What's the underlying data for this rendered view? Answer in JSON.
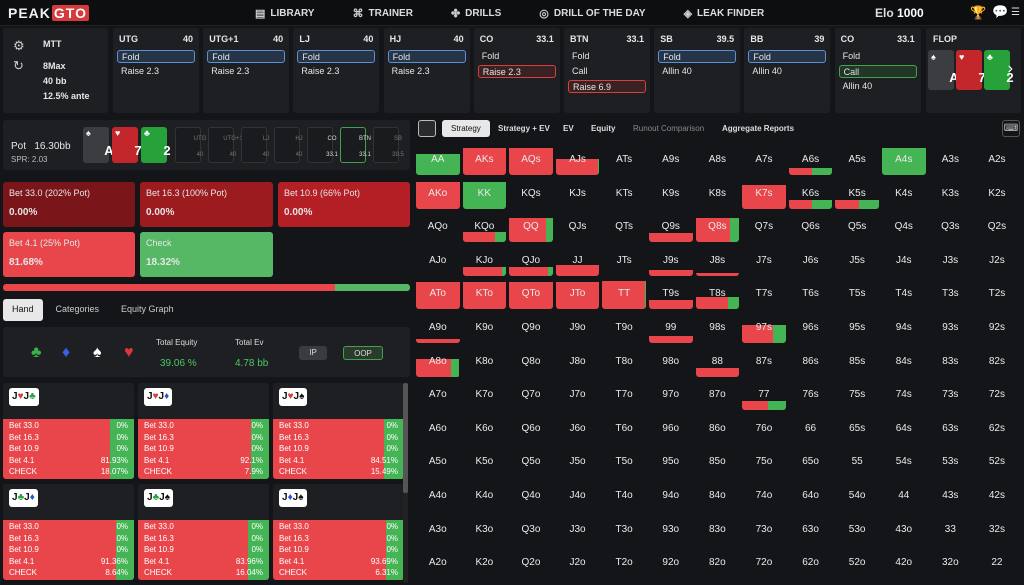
{
  "nav": {
    "logo_a": "PEAK",
    "logo_b": "GTO",
    "items": [
      {
        "icon": "book-icon",
        "label": "LIBRARY"
      },
      {
        "icon": "gamepad-icon",
        "label": "TRAINER"
      },
      {
        "icon": "drills-icon",
        "label": "DRILLS"
      },
      {
        "icon": "target-icon",
        "label": "DRILL OF THE DAY"
      },
      {
        "icon": "drop-icon",
        "label": "LEAK FINDER"
      }
    ],
    "elo_label": "Elo",
    "elo_value": "1000"
  },
  "setup": {
    "format": "MTT",
    "table": "8Max",
    "stack": "40 bb",
    "ante": "12.5% ante"
  },
  "positions": [
    {
      "name": "UTG",
      "stack": "40",
      "opts": [
        {
          "t": "Fold",
          "s": "sel"
        },
        {
          "t": "Raise 2.3",
          "s": ""
        }
      ]
    },
    {
      "name": "UTG+1",
      "stack": "40",
      "opts": [
        {
          "t": "Fold",
          "s": "sel"
        },
        {
          "t": "Raise 2.3",
          "s": ""
        }
      ]
    },
    {
      "name": "LJ",
      "stack": "40",
      "opts": [
        {
          "t": "Fold",
          "s": "sel"
        },
        {
          "t": "Raise 2.3",
          "s": ""
        }
      ]
    },
    {
      "name": "HJ",
      "stack": "40",
      "opts": [
        {
          "t": "Fold",
          "s": "sel"
        },
        {
          "t": "Raise 2.3",
          "s": ""
        }
      ]
    },
    {
      "name": "CO",
      "stack": "33.1",
      "opts": [
        {
          "t": "Fold",
          "s": ""
        },
        {
          "t": "Raise 2.3",
          "s": "selr"
        }
      ]
    },
    {
      "name": "BTN",
      "stack": "33.1",
      "opts": [
        {
          "t": "Fold",
          "s": ""
        },
        {
          "t": "Call",
          "s": ""
        },
        {
          "t": "Raise 6.9",
          "s": "selr"
        }
      ]
    },
    {
      "name": "SB",
      "stack": "39.5",
      "opts": [
        {
          "t": "Fold",
          "s": "sel"
        },
        {
          "t": "Allin 40",
          "s": ""
        }
      ]
    },
    {
      "name": "BB",
      "stack": "39",
      "opts": [
        {
          "t": "Fold",
          "s": "sel"
        },
        {
          "t": "Allin 40",
          "s": ""
        }
      ]
    },
    {
      "name": "CO",
      "stack": "33.1",
      "opts": [
        {
          "t": "Fold",
          "s": ""
        },
        {
          "t": "Call",
          "s": "selg"
        },
        {
          "t": "Allin 40",
          "s": ""
        }
      ]
    }
  ],
  "flop": {
    "label": "FLOP",
    "cards": [
      {
        "rank": "A",
        "suit": "♠",
        "color": "#3c3d40"
      },
      {
        "rank": "7",
        "suit": "♥",
        "color": "#c3262b"
      },
      {
        "rank": "2",
        "suit": "♣",
        "color": "#27a13a"
      }
    ]
  },
  "pot": {
    "label": "Pot",
    "value": "16.30bb",
    "spr": "SPR: 2.03",
    "seats": [
      {
        "n": "UTG",
        "s": "40"
      },
      {
        "n": "UTG+1",
        "s": "40"
      },
      {
        "n": "LJ",
        "s": "40"
      },
      {
        "n": "HJ",
        "s": "40"
      },
      {
        "n": "CO",
        "s": "33.1"
      },
      {
        "n": "BTN",
        "s": "33.1"
      },
      {
        "n": "SB",
        "s": "39.5"
      }
    ]
  },
  "actions": [
    {
      "label": "Bet 33.0 (202% Pot)",
      "value": "0.00%",
      "color": "#7a1519"
    },
    {
      "label": "Bet 16.3 (100% Pot)",
      "value": "0.00%",
      "color": "#9c1b1f"
    },
    {
      "label": "Bet 10.9 (66% Pot)",
      "value": "0.00%",
      "color": "#b31f24"
    },
    {
      "label": "Bet 4.1 (25% Pot)",
      "value": "81.68%",
      "color": "#e8464b"
    },
    {
      "label": "Check",
      "value": "18.32%",
      "color": "#56b864"
    }
  ],
  "freq": {
    "bet": 81.68,
    "check": 18.32
  },
  "panel_tabs": [
    "Hand",
    "Categories",
    "Equity Graph"
  ],
  "equity": {
    "suits": [
      {
        "s": "♣",
        "c": "#3ab34a"
      },
      {
        "s": "♦",
        "c": "#3a5fe0"
      },
      {
        "s": "♠",
        "c": "#ffffff"
      },
      {
        "s": "♥",
        "c": "#e0353a"
      }
    ],
    "total_equity_label": "Total Equity",
    "total_equity": "39.06 %",
    "total_ev_label": "Total Ev",
    "total_ev": "4.78 bb",
    "ip": "IP",
    "oop": "OOP"
  },
  "hand_cards": [
    {
      "cards": [
        [
          "J",
          "♥",
          "r"
        ],
        [
          "J",
          "♣",
          "g"
        ]
      ],
      "rows": [
        [
          "Bet 33.0",
          "0%"
        ],
        [
          "Bet 16.3",
          "0%"
        ],
        [
          "Bet 10.9",
          "0%"
        ],
        [
          "Bet 4.1",
          "81.93%"
        ],
        [
          "CHECK",
          "18.07%"
        ]
      ],
      "check": 18.07
    },
    {
      "cards": [
        [
          "J",
          "♥",
          "r"
        ],
        [
          "J",
          "♦",
          "b"
        ]
      ],
      "rows": [
        [
          "Bet 33.0",
          "0%"
        ],
        [
          "Bet 16.3",
          "0%"
        ],
        [
          "Bet 10.9",
          "0%"
        ],
        [
          "Bet 4.1",
          "92.1%"
        ],
        [
          "CHECK",
          "7.9%"
        ]
      ],
      "check": 7.9
    },
    {
      "cards": [
        [
          "J",
          "♥",
          "r"
        ],
        [
          "J",
          "♠",
          "k"
        ]
      ],
      "rows": [
        [
          "Bet 33.0",
          "0%"
        ],
        [
          "Bet 16.3",
          "0%"
        ],
        [
          "Bet 10.9",
          "0%"
        ],
        [
          "Bet 4.1",
          "84.51%"
        ],
        [
          "CHECK",
          "15.49%"
        ]
      ],
      "check": 15.49
    },
    {
      "cards": [
        [
          "J",
          "♣",
          "g"
        ],
        [
          "J",
          "♦",
          "b"
        ]
      ],
      "rows": [
        [
          "Bet 33.0",
          "0%"
        ],
        [
          "Bet 16.3",
          "0%"
        ],
        [
          "Bet 10.9",
          "0%"
        ],
        [
          "Bet 4.1",
          "91.36%"
        ],
        [
          "CHECK",
          "8.64%"
        ]
      ],
      "check": 8.64
    },
    {
      "cards": [
        [
          "J",
          "♣",
          "g"
        ],
        [
          "J",
          "♠",
          "k"
        ]
      ],
      "rows": [
        [
          "Bet 33.0",
          "0%"
        ],
        [
          "Bet 16.3",
          "0%"
        ],
        [
          "Bet 10.9",
          "0%"
        ],
        [
          "Bet 4.1",
          "83.96%"
        ],
        [
          "CHECK",
          "16.04%"
        ]
      ],
      "check": 16.04
    },
    {
      "cards": [
        [
          "J",
          "♦",
          "b"
        ],
        [
          "J",
          "♠",
          "k"
        ]
      ],
      "rows": [
        [
          "Bet 33.0",
          "0%"
        ],
        [
          "Bet 16.3",
          "0%"
        ],
        [
          "Bet 10.9",
          "0%"
        ],
        [
          "Bet 4.1",
          "93.69%"
        ],
        [
          "CHECK",
          "6.31%"
        ]
      ],
      "check": 6.31
    }
  ],
  "range_tabs": [
    "Strategy",
    "Strategy + EV",
    "EV",
    "Equity",
    "Runout Comparison",
    "Aggregate Reports"
  ],
  "matrix": {
    "ranks": [
      "A",
      "K",
      "Q",
      "J",
      "T",
      "9",
      "8",
      "7",
      "6",
      "5",
      "4",
      "3",
      "2"
    ],
    "cells": {
      "0,0": [
        0,
        0,
        1,
        0.7
      ],
      "0,1": [
        0,
        1,
        1,
        0.9
      ],
      "0,2": [
        0,
        1,
        1,
        0.9
      ],
      "0,3": [
        0,
        0.98,
        1,
        0.55
      ],
      "0,7": [
        0,
        0,
        0,
        0
      ],
      "0,8": [
        0.1,
        0.6,
        0.9,
        0.25
      ],
      "0,10": [
        0,
        0,
        0,
        0.9,
        "g"
      ],
      "1,0": [
        0,
        1,
        1,
        0.9
      ],
      "1,1": [
        0,
        0,
        1,
        0.9
      ],
      "1,7": [
        0,
        1,
        1,
        0.8
      ],
      "1,8": [
        0.1,
        0.6,
        0.9,
        0.3
      ],
      "1,9": [
        0.1,
        0.6,
        0.9,
        0.3
      ],
      "2,0": [
        0,
        0,
        0,
        0
      ],
      "2,1": [
        0,
        0.75,
        1,
        0.35
      ],
      "2,2": [
        0,
        0.85,
        1,
        0.8
      ],
      "2,5": [
        0,
        1,
        1,
        0.3
      ],
      "2,6": [
        0,
        0.8,
        1,
        0.8
      ],
      "3,1": [
        0,
        0.9,
        1,
        0.3
      ],
      "3,2": [
        0,
        0.9,
        1,
        0.3
      ],
      "3,3": [
        0,
        1,
        1,
        0.35
      ],
      "3,5": [
        0,
        1,
        1,
        0.2
      ],
      "3,6": [
        0,
        1,
        1,
        0.1
      ],
      "4,0": [
        0,
        1,
        1,
        0.9
      ],
      "4,1": [
        0,
        1,
        1,
        0.9
      ],
      "4,2": [
        0,
        1,
        1,
        0.9
      ],
      "4,3": [
        0,
        1,
        1,
        0.9
      ],
      "4,4": [
        0,
        0.98,
        1,
        0.95
      ],
      "4,5": [
        0,
        1,
        1,
        0.3
      ],
      "4,6": [
        0,
        0.75,
        1,
        0.4
      ],
      "5,0": [
        0,
        1,
        1,
        0.15
      ],
      "5,5": [
        0,
        1,
        1,
        0.25
      ],
      "5,7": [
        0,
        0.7,
        1,
        0.6
      ],
      "6,0": [
        0,
        0.8,
        1,
        0.6
      ],
      "6,6": [
        0,
        1,
        1,
        0.3
      ],
      "7,7": [
        0,
        0.6,
        1,
        0.3
      ]
    }
  }
}
